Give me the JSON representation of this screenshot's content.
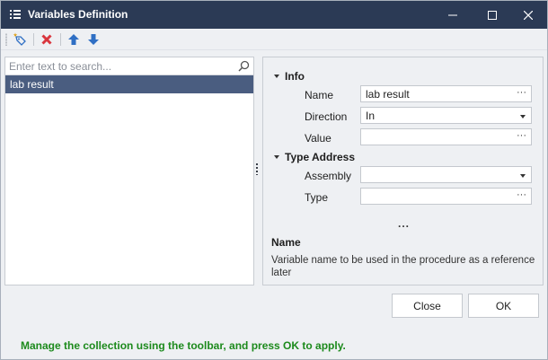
{
  "window": {
    "title": "Variables Definition"
  },
  "toolbar": {
    "buttons": [
      {
        "name": "add",
        "icon": "add-tag-icon"
      },
      {
        "name": "delete",
        "icon": "red-x-icon"
      },
      {
        "name": "move-up",
        "icon": "arrow-up-icon"
      },
      {
        "name": "move-down",
        "icon": "arrow-down-icon"
      }
    ]
  },
  "list": {
    "search_placeholder": "Enter text to search...",
    "items": [
      "lab result"
    ],
    "selected_index": 0
  },
  "properties": {
    "info_category": "Info",
    "name_label": "Name",
    "name_value": "lab result",
    "direction_label": "Direction",
    "direction_value": "In",
    "value_label": "Value",
    "value_value": "",
    "type_address_category": "Type Address",
    "assembly_label": "Assembly",
    "assembly_value": "",
    "type_label": "Type",
    "type_value": "",
    "ellipsis": "...",
    "field_ellipsis": "···"
  },
  "description": {
    "title": "Name",
    "text": "Variable name to be used in the procedure as a reference later"
  },
  "buttons": {
    "close_label": "Close",
    "ok_label": "OK"
  },
  "status": {
    "message": "Manage the collection using the toolbar, and press OK to apply."
  },
  "colors": {
    "titlebar": "#2b3a55",
    "selection": "#4a5d80",
    "status_text": "#1c8a1c",
    "delete_icon": "#d9363e",
    "arrow_icon": "#2f6fc4"
  }
}
